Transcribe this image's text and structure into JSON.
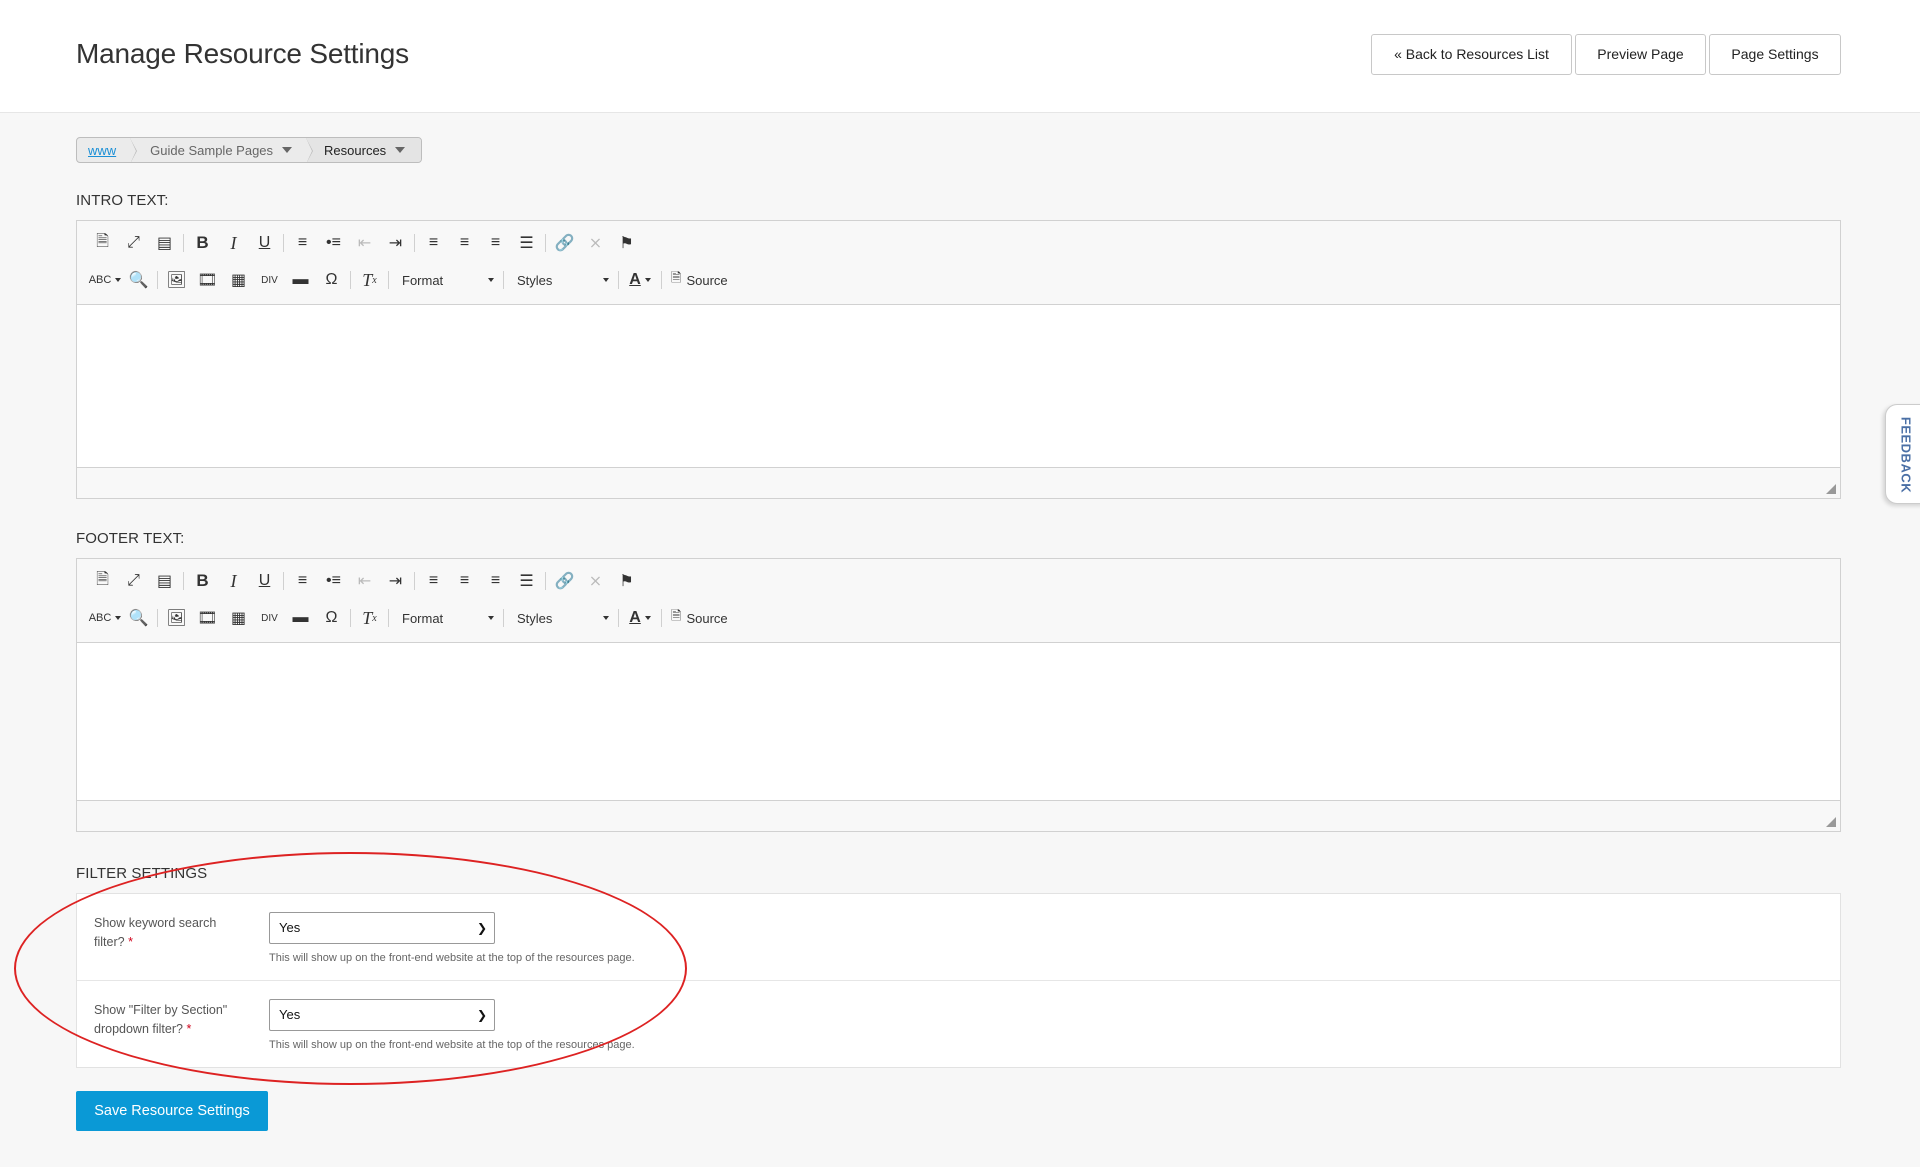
{
  "header": {
    "title": "Manage Resource Settings",
    "buttons": {
      "back": "« Back to Resources List",
      "preview": "Preview Page",
      "settings": "Page Settings"
    }
  },
  "breadcrumb": {
    "items": [
      "www",
      "Guide Sample Pages",
      "Resources"
    ]
  },
  "intro": {
    "label": "INTRO TEXT:"
  },
  "footer": {
    "label": "FOOTER TEXT:"
  },
  "toolbar": {
    "format_label": "Format",
    "styles_label": "Styles",
    "source_label": "Source",
    "icons_row1": [
      "new-page-icon",
      "maximize-icon",
      "show-blocks-icon",
      "bold-icon",
      "italic-icon",
      "underline-icon",
      "numbered-list-icon",
      "bulleted-list-icon",
      "outdent-icon",
      "indent-icon",
      "align-left-icon",
      "align-center-icon",
      "align-right-icon",
      "justify-icon",
      "link-icon",
      "unlink-icon",
      "anchor-icon"
    ],
    "icons_row2": [
      "spellcheck-icon",
      "find-icon",
      "image-icon",
      "video-icon",
      "table-icon",
      "div-icon",
      "horizontal-rule-icon",
      "special-char-icon",
      "remove-format-icon",
      "text-color-icon",
      "source-icon"
    ]
  },
  "filter": {
    "title": "FILTER SETTINGS",
    "rows": [
      {
        "label": "Show keyword search filter?",
        "required_mark": "*",
        "value": "Yes",
        "hint": "This will show up on the front-end website at the top of the resources page."
      },
      {
        "label": "Show \"Filter by Section\" dropdown filter?",
        "required_mark": "*",
        "value": "Yes",
        "hint": "This will show up on the front-end website at the top of the resources page."
      }
    ]
  },
  "save_button": "Save Resource Settings",
  "feedback_tab": "FEEDBACK",
  "colors": {
    "primary": "#0a99d6",
    "annotation": "#dd2222",
    "link": "#1a8fd6"
  }
}
